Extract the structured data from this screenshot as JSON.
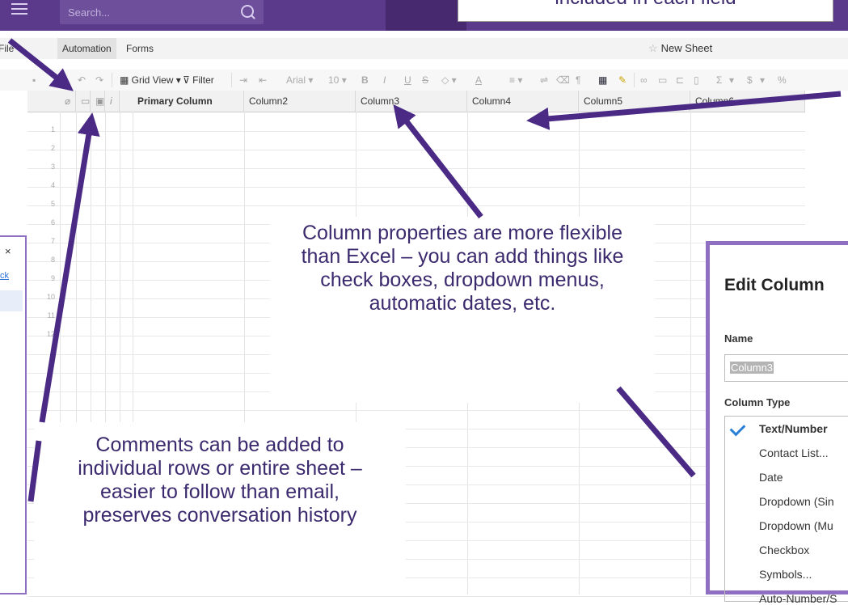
{
  "top_bar": {
    "search_placeholder": "Search...",
    "callout_text": "included in each field"
  },
  "menubar": {
    "items": [
      "File",
      "Automation",
      "Forms"
    ],
    "sheet_name": "New Sheet"
  },
  "toolbar": {
    "grid_view": "Grid View",
    "filter": "Filter",
    "font": "Arial",
    "font_size": "10",
    "glyphs": [
      "B",
      "I",
      "U",
      "S",
      "A",
      "Σ",
      "$",
      "%"
    ]
  },
  "grid": {
    "columns": [
      "Primary Column",
      "Column2",
      "Column3",
      "Column4",
      "Column5",
      "Column6"
    ],
    "row_numbers": [
      "1",
      "2",
      "3",
      "4",
      "5",
      "6",
      "7",
      "8",
      "9",
      "10",
      "11",
      "12"
    ]
  },
  "left_panel": {
    "close": "×",
    "link": "ck"
  },
  "edit_column": {
    "title": "Edit Column",
    "name_label": "Name",
    "name_value": "Column3",
    "type_label": "Column Type",
    "options": [
      "Text/Number",
      "Contact List...",
      "Date",
      "Dropdown (Sin",
      "Dropdown (Mu",
      "Checkbox",
      "Symbols...",
      "Auto-Number/S"
    ]
  },
  "callouts": {
    "column_properties": "Column properties are more flexible than Excel – you can add things like check boxes, dropdown menus, automatic dates, etc.",
    "comments": "Comments can be added to individual rows or entire sheet – easier to follow than email, preserves conversation history"
  },
  "colors": {
    "brand": "#5b3a8c",
    "arrow": "#4a2a85",
    "dialog_border": "#8e6fc2",
    "callout_text": "#3c2a6e"
  }
}
